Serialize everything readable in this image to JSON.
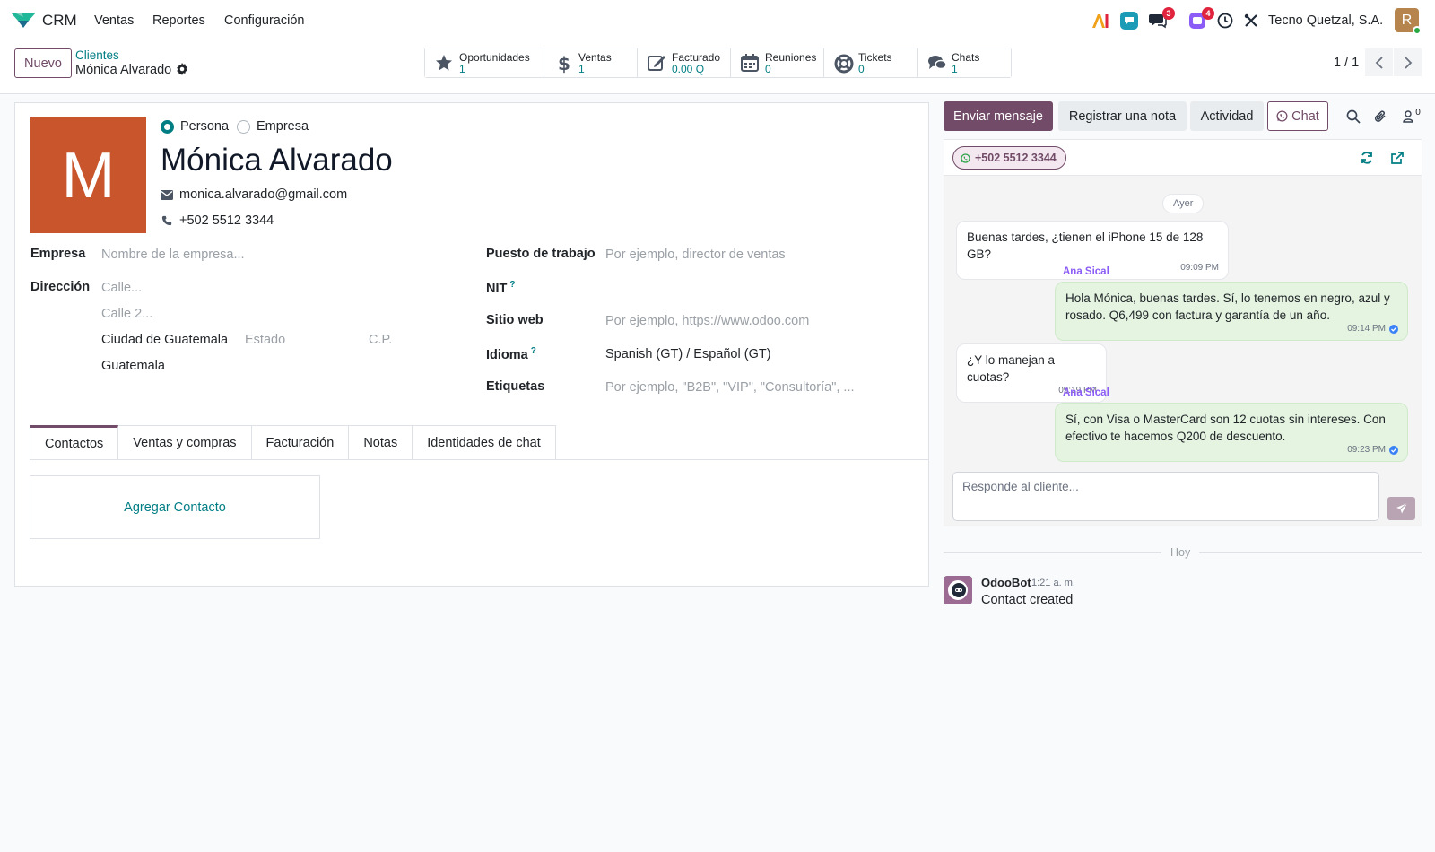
{
  "app": {
    "name": "CRM",
    "logo_icon": "crm-logo-icon"
  },
  "nav": {
    "menu": [
      "Ventas",
      "Reportes",
      "Configuración"
    ],
    "company": "Tecno Quetzal, S.A.",
    "user_initial": "R",
    "badges": {
      "discuss": "3",
      "activities": "4"
    }
  },
  "control": {
    "new_label": "Nuevo",
    "breadcrumb_parent": "Clientes",
    "breadcrumb_current": "Mónica Alvarado",
    "pager": "1 / 1",
    "stats": [
      {
        "label": "Oportunidades",
        "value": "1",
        "icon": "star-icon"
      },
      {
        "label": "Ventas",
        "value": "1",
        "icon": "dollar-icon"
      },
      {
        "label": "Facturado",
        "value": "0.00 Q",
        "icon": "invoice-edit-icon"
      },
      {
        "label": "Reuniones",
        "value": "0",
        "icon": "calendar-icon"
      },
      {
        "label": "Tickets",
        "value": "0",
        "icon": "lifebuoy-icon"
      },
      {
        "label": "Chats",
        "value": "1",
        "icon": "chats-icon"
      }
    ]
  },
  "partner": {
    "avatar_letter": "M",
    "type_person": "Persona",
    "type_company": "Empresa",
    "name": "Mónica Alvarado",
    "email": "monica.alvarado@gmail.com",
    "phone": "+502 5512 3344"
  },
  "form": {
    "company_label": "Empresa",
    "company_placeholder": "Nombre de la empresa...",
    "address_label": "Dirección",
    "street_placeholder": "Calle...",
    "street2_placeholder": "Calle 2...",
    "city": "Ciudad de Guatemala",
    "state_placeholder": "Estado",
    "zip_placeholder": "C.P.",
    "country": "Guatemala",
    "job_label": "Puesto de trabajo",
    "job_placeholder": "Por ejemplo, director de ventas",
    "nit_label": "NIT",
    "help_mark": "?",
    "website_label": "Sitio web",
    "website_placeholder": "Por ejemplo, https://www.odoo.com",
    "language_label": "Idioma",
    "language_value": "Spanish (GT) / Español (GT)",
    "tags_label": "Etiquetas",
    "tags_placeholder": "Por ejemplo, \"B2B\", \"VIP\", \"Consultoría\", ..."
  },
  "tabs": [
    "Contactos",
    "Ventas y compras",
    "Facturación",
    "Notas",
    "Identidades de chat"
  ],
  "active_tab": "Contactos",
  "add_contact_label": "Agregar Contacto",
  "chatter": {
    "send_message": "Enviar mensaje",
    "log_note": "Registrar una nota",
    "activity": "Actividad",
    "chat": "Chat",
    "followers_count": "0",
    "whatsapp": {
      "phone": "+502 5512 3344",
      "day_label": "Ayer",
      "messages": [
        {
          "dir": "in",
          "text": "Buenas tardes, ¿tienen el iPhone 15 de 128 GB?",
          "time": "09:09 PM"
        },
        {
          "dir": "out",
          "sender": "Ana Sical",
          "text": "Hola Mónica, buenas tardes. Sí, lo tenemos en negro, azul y rosado. Q6,499 con factura y garantía de un año.",
          "time": "09:14 PM"
        },
        {
          "dir": "in",
          "text": "¿Y lo manejan a cuotas?",
          "time": "09:19 PM"
        },
        {
          "dir": "out",
          "sender": "Ana Sical",
          "text": "Sí, con Visa o MasterCard son 12 cuotas sin intereses. Con efectivo te hacemos Q200 de descuento.",
          "time": "09:23 PM"
        }
      ],
      "composer_placeholder": "Responde al cliente..."
    },
    "today_label": "Hoy",
    "log": {
      "author": "OdooBot",
      "time": "1:21 a. m.",
      "message": "Contact created"
    }
  },
  "colors": {
    "brand": "#714b67",
    "accent": "#017e84",
    "avatar_bg": "#c8552b",
    "whatsapp_out": "#e4f4e1"
  }
}
